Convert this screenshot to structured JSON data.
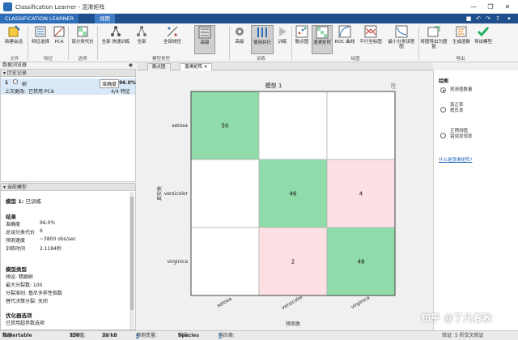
{
  "window": {
    "title": "Classification Learner - 混淆矩阵",
    "controls": [
      "—",
      "❐",
      "✕"
    ]
  },
  "ribbon_tabs": [
    {
      "label": "CLASSIFICATION LEARNER"
    },
    {
      "label": "视图"
    }
  ],
  "ribbon": {
    "groups": [
      "文件",
      "特征",
      "选项",
      "模型类型",
      "训练",
      "绘图",
      "导出"
    ],
    "buttons": {
      "new_session": "新建会话",
      "feature_select": "特征选择",
      "pca": "PCA",
      "misclass_cost": "误分类代价",
      "all_quick": "全部 快速训练",
      "all": "全部",
      "all_linear": "全部线性",
      "model_sel": "高级",
      "advanced": "高级",
      "use_parallel": "使用并行",
      "train": "训练",
      "scatter": "散点图",
      "confusion": "混淆矩阵",
      "roc": "ROC 曲线",
      "parallel": "平行坐标图",
      "min_class": "最小分类误差图",
      "export_plot": "将图导出为图窗",
      "gen_func": "生成函数",
      "export_model": "导出模型"
    }
  },
  "left": {
    "data_browser": "数据浏览器",
    "history": {
      "title": "历史记录",
      "item_index": "1",
      "item_name": "树",
      "item_accuracy_label": "准确度",
      "item_accuracy": "96.0%",
      "last_change_label": "上次更改:",
      "last_change": "已禁用 PCA",
      "features": "4/4 特征"
    },
    "current_model": {
      "title": "当前模型",
      "model_label": "模型 1:",
      "model_status": "已训练",
      "results_title": "结果",
      "results": [
        {
          "k": "准确度",
          "v": "96.0%"
        },
        {
          "k": "总误分类代价",
          "v": "6"
        },
        {
          "k": "预测速度",
          "v": "~3800 obs/sec"
        },
        {
          "k": "训练时间",
          "v": "2.1184秒"
        }
      ],
      "type_title": "模型类型",
      "type_lines": [
        "预设: 精细树",
        "最大分裂数: 100",
        "分裂准则: 基尼多样性指数",
        "替代决策分裂: 关闭"
      ],
      "opt_title": "优化器选项",
      "opt_line": "已禁用超参数选项"
    }
  },
  "doc_tabs": [
    {
      "label": "散点图"
    },
    {
      "label": "混淆矩阵"
    }
  ],
  "chart_data": {
    "type": "heatmap",
    "title": "模型 1",
    "ylabel": "真实类",
    "xlabel": "预测类",
    "classes": [
      "setosa",
      "versicolor",
      "virginica"
    ],
    "matrix": [
      [
        50,
        0,
        0
      ],
      [
        0,
        46,
        4
      ],
      [
        0,
        2,
        48
      ]
    ],
    "colors": {
      "correct": "#8fdbaa",
      "wrong": "#fde0e3",
      "empty": "#ffffff"
    }
  },
  "right": {
    "section": "绘图",
    "options": [
      {
        "label": "观测值数量",
        "selected": true
      },
      {
        "label": "真正率\n假负率",
        "selected": false
      },
      {
        "label": "正预测值\n错误发现率",
        "selected": false
      }
    ],
    "link": "什么是混淆矩阵?"
  },
  "status": {
    "data_label": "数据:",
    "data_value": "fishertable",
    "obs_label": "观测值:",
    "obs_value": "150",
    "size_label": "大小:",
    "size_value": "26 kB",
    "pred_label": "预测变量:",
    "pred_value": "4",
    "resp_label": "响应:",
    "resp_value": "Species",
    "cls_label": "响应类:",
    "cls_value": "3",
    "validation": "验证: 5 折交叉验证"
  },
  "watermark": "知乎 @了凡春秋"
}
